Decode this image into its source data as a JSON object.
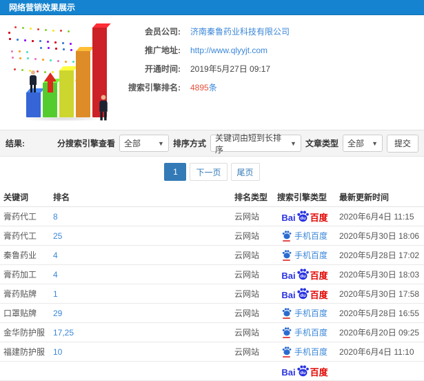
{
  "header": {
    "title": "网络营销效果展示"
  },
  "info": {
    "company_label": "会员公司:",
    "company_value": "济南秦鲁药业科技有限公司",
    "url_label": "推广地址:",
    "url_value": "http://www.qlyyjt.com",
    "open_label": "开通时间:",
    "open_value": "2019年5月27日 09:17",
    "rank_label": "搜索引擎排名:",
    "rank_value": "4895",
    "rank_unit": "条"
  },
  "filters": {
    "result_label": "结果:",
    "engine_view_label": "分搜索引擎查看",
    "engine_view_value": "全部",
    "sort_label": "排序方式",
    "sort_value": "关键词由短到长排序",
    "article_type_label": "文章类型",
    "article_type_value": "全部",
    "submit_label": "提交"
  },
  "pagination": {
    "current": "1",
    "next": "下一页",
    "last": "尾页"
  },
  "table": {
    "headers": [
      "关键词",
      "排名",
      "排名类型",
      "搜索引擎类型",
      "最新更新时间"
    ],
    "engine_text": {
      "baidu_bai": "Bai",
      "baidu_du": "du",
      "baidu_cn": "百度",
      "mobile": "手机百度"
    },
    "rows": [
      {
        "keyword": "膏药代工",
        "rank": "8",
        "type": "云网站",
        "engine": "baidu",
        "updated": "2020年6月4日 11:15"
      },
      {
        "keyword": "膏药代工",
        "rank": "25",
        "type": "云网站",
        "engine": "mobile",
        "updated": "2020年5月30日 18:06"
      },
      {
        "keyword": "秦鲁药业",
        "rank": "4",
        "type": "云网站",
        "engine": "mobile",
        "updated": "2020年5月28日 17:02"
      },
      {
        "keyword": "膏药加工",
        "rank": "4",
        "type": "云网站",
        "engine": "baidu",
        "updated": "2020年5月30日 18:03"
      },
      {
        "keyword": "膏药贴牌",
        "rank": "1",
        "type": "云网站",
        "engine": "baidu",
        "updated": "2020年5月30日 17:58"
      },
      {
        "keyword": "口罩贴牌",
        "rank": "29",
        "type": "云网站",
        "engine": "mobile",
        "updated": "2020年5月28日 16:55"
      },
      {
        "keyword": "金华防护服",
        "rank": "17,25",
        "type": "云网站",
        "engine": "mobile",
        "updated": "2020年6月20日 09:25"
      },
      {
        "keyword": "福建防护服",
        "rank": "10",
        "type": "云网站",
        "engine": "mobile",
        "updated": "2020年6月4日 11:10"
      },
      {
        "keyword": "",
        "rank": "",
        "type": "",
        "engine": "baidu",
        "updated": "",
        "partial": true
      }
    ]
  },
  "colors": {
    "titlebar_bg": "#1583cf",
    "link_blue": "#3b87d8",
    "rank_count_red": "#e4503a",
    "pager_active_blue": "#337ab7",
    "baidu_blue": "#2932e1",
    "baidu_red": "#e10602",
    "bar_colors": [
      "#3565d6",
      "#55cc2e",
      "#ccd62e",
      "#dd8c28",
      "#cc2127"
    ]
  }
}
